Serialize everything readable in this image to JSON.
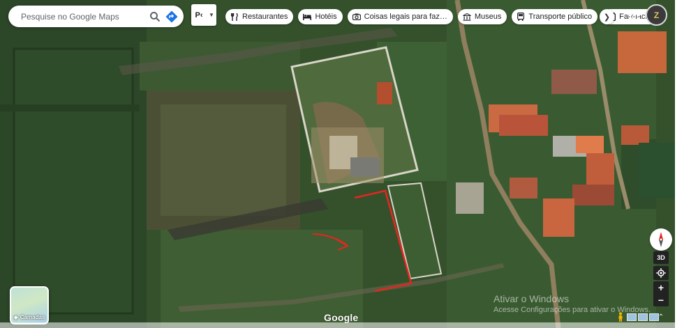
{
  "search": {
    "placeholder": "Pesquise no Google Maps"
  },
  "place_filter": {
    "label": "P‹"
  },
  "chips": [
    {
      "label": "Restaurantes",
      "icon": "fork-knife-icon"
    },
    {
      "label": "Hotéis",
      "icon": "bed-icon"
    },
    {
      "label": "Coisas legais para faz…",
      "icon": "camera-icon"
    },
    {
      "label": "Museus",
      "icon": "museum-icon"
    },
    {
      "label": "Transporte público",
      "icon": "bus-icon"
    },
    {
      "label": "Farmácias",
      "icon": "pharmacy-icon"
    }
  ],
  "avatar": {
    "label": "Z"
  },
  "layers": {
    "label": "Camadas"
  },
  "controls": {
    "three_d": "3D",
    "zoom_in": "+",
    "zoom_out": "−"
  },
  "brand": {
    "logo_text": "Google"
  },
  "watermark": {
    "line1": "Ativar o Windows",
    "line2": "Acesse Configurações para ativar o Windows."
  },
  "colors": {
    "annotation": "#e8251f",
    "directions": "#1a73e8"
  }
}
